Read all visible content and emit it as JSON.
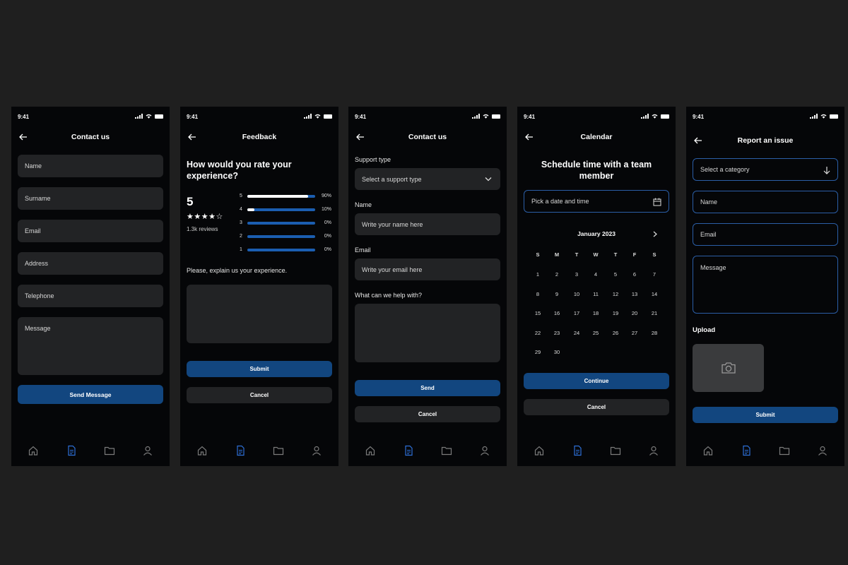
{
  "status": {
    "time": "9:41"
  },
  "colors": {
    "primary": "#12467f",
    "field_bg": "#222325",
    "phone_bg": "#050608",
    "page_bg": "#1f1f1f",
    "accent": "#1b5eb1"
  },
  "nav_icons": [
    "home-icon",
    "document-icon",
    "folder-icon",
    "user-icon"
  ],
  "screen1": {
    "title": "Contact us",
    "fields": [
      "Name",
      "Surname",
      "Email",
      "Address",
      "Telephone"
    ],
    "message_placeholder": "Message",
    "send_label": "Send Message"
  },
  "screen2": {
    "title": "Feedback",
    "question": "How would you rate your experience?",
    "rating_value": "5",
    "stars": 4,
    "reviews": "1.3k reviews",
    "breakdown": [
      {
        "star": "5",
        "percent": "90%",
        "fill": 0.9
      },
      {
        "star": "4",
        "percent": "10%",
        "fill": 0.1
      },
      {
        "star": "3",
        "percent": "0%",
        "fill": 0
      },
      {
        "star": "2",
        "percent": "0%",
        "fill": 0
      },
      {
        "star": "1",
        "percent": "0%",
        "fill": 0
      }
    ],
    "explain_label": "Please, explain us your experience.",
    "submit_label": "Submit",
    "cancel_label": "Cancel"
  },
  "screen3": {
    "title": "Contact us",
    "support_label": "Support type",
    "support_placeholder": "Select a support type",
    "name_label": "Name",
    "name_placeholder": "Write your name here",
    "email_label": "Email",
    "email_placeholder": "Write your email here",
    "help_label": "What can we help with?",
    "send_label": "Send",
    "cancel_label": "Cancel"
  },
  "screen4": {
    "title": "Calendar",
    "heading": "Schedule time with a team member",
    "picker_placeholder": "Pick  a date and time",
    "month": "January 2023",
    "dow": [
      "S",
      "M",
      "T",
      "W",
      "T",
      "F",
      "S"
    ],
    "days": [
      "1",
      "2",
      "3",
      "4",
      "5",
      "6",
      "7",
      "8",
      "9",
      "10",
      "11",
      "12",
      "13",
      "14",
      "15",
      "16",
      "17",
      "18",
      "19",
      "20",
      "21",
      "22",
      "23",
      "24",
      "25",
      "26",
      "27",
      "28",
      "29",
      "30"
    ],
    "continue_label": "Continue",
    "cancel_label": "Cancel"
  },
  "screen5": {
    "title": "Report an issue",
    "category_placeholder": "Select  a category",
    "name_placeholder": "Name",
    "email_placeholder": "Email",
    "message_placeholder": "Message",
    "upload_label": "Upload",
    "submit_label": "Submit"
  }
}
